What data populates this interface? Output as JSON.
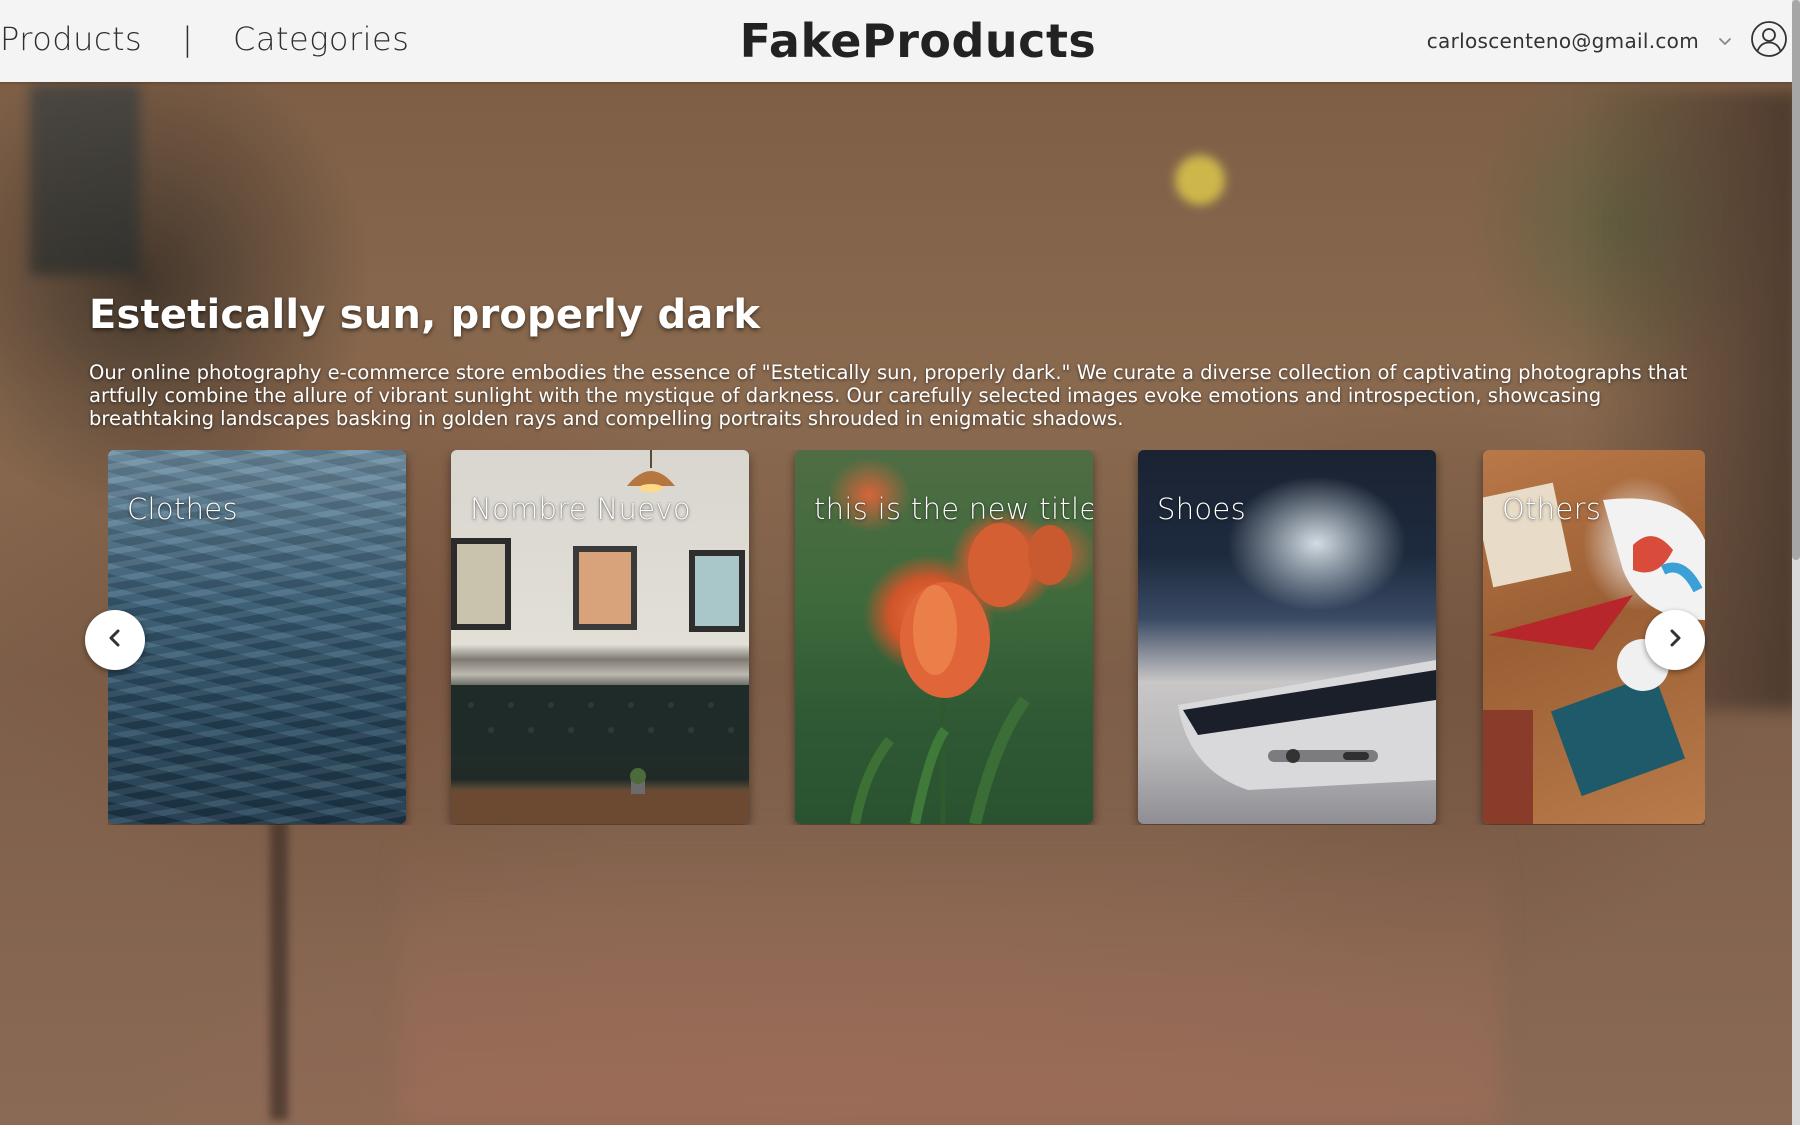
{
  "header": {
    "nav_products": "Products",
    "nav_separator": "|",
    "nav_categories": "Categories",
    "brand": "FakeProducts",
    "user_email": "carloscenteno@gmail.com"
  },
  "hero": {
    "title": "Estetically sun, properly dark",
    "description": "Our online photography e-commerce store embodies the essence of \"Estetically sun, properly dark.\" We curate a diverse collection of captivating photographs that artfully combine the allure of vibrant sunlight with the mystique of darkness. Our carefully selected images evoke emotions and introspection, showcasing breathtaking landscapes basking in golden rays and compelling portraits shrouded in enigmatic shadows."
  },
  "carousel": {
    "cards": [
      {
        "label": "Clothes",
        "image": "water-waves"
      },
      {
        "label": "Nombre Nuevo",
        "image": "cafe-interior"
      },
      {
        "label": "this is the new title",
        "image": "orange-tulips"
      },
      {
        "label": "Shoes",
        "image": "smartphone-closeup"
      },
      {
        "label": "Others",
        "image": "school-supplies-desk"
      }
    ],
    "prev_icon": "chevron-left-icon",
    "next_icon": "chevron-right-icon"
  },
  "icons": {
    "user_menu": "chevron-down-icon",
    "avatar": "user-circle-icon"
  },
  "colors": {
    "header_bg": "#f4f4f4",
    "text_dark": "#222222",
    "hero_text": "#ffffff"
  }
}
